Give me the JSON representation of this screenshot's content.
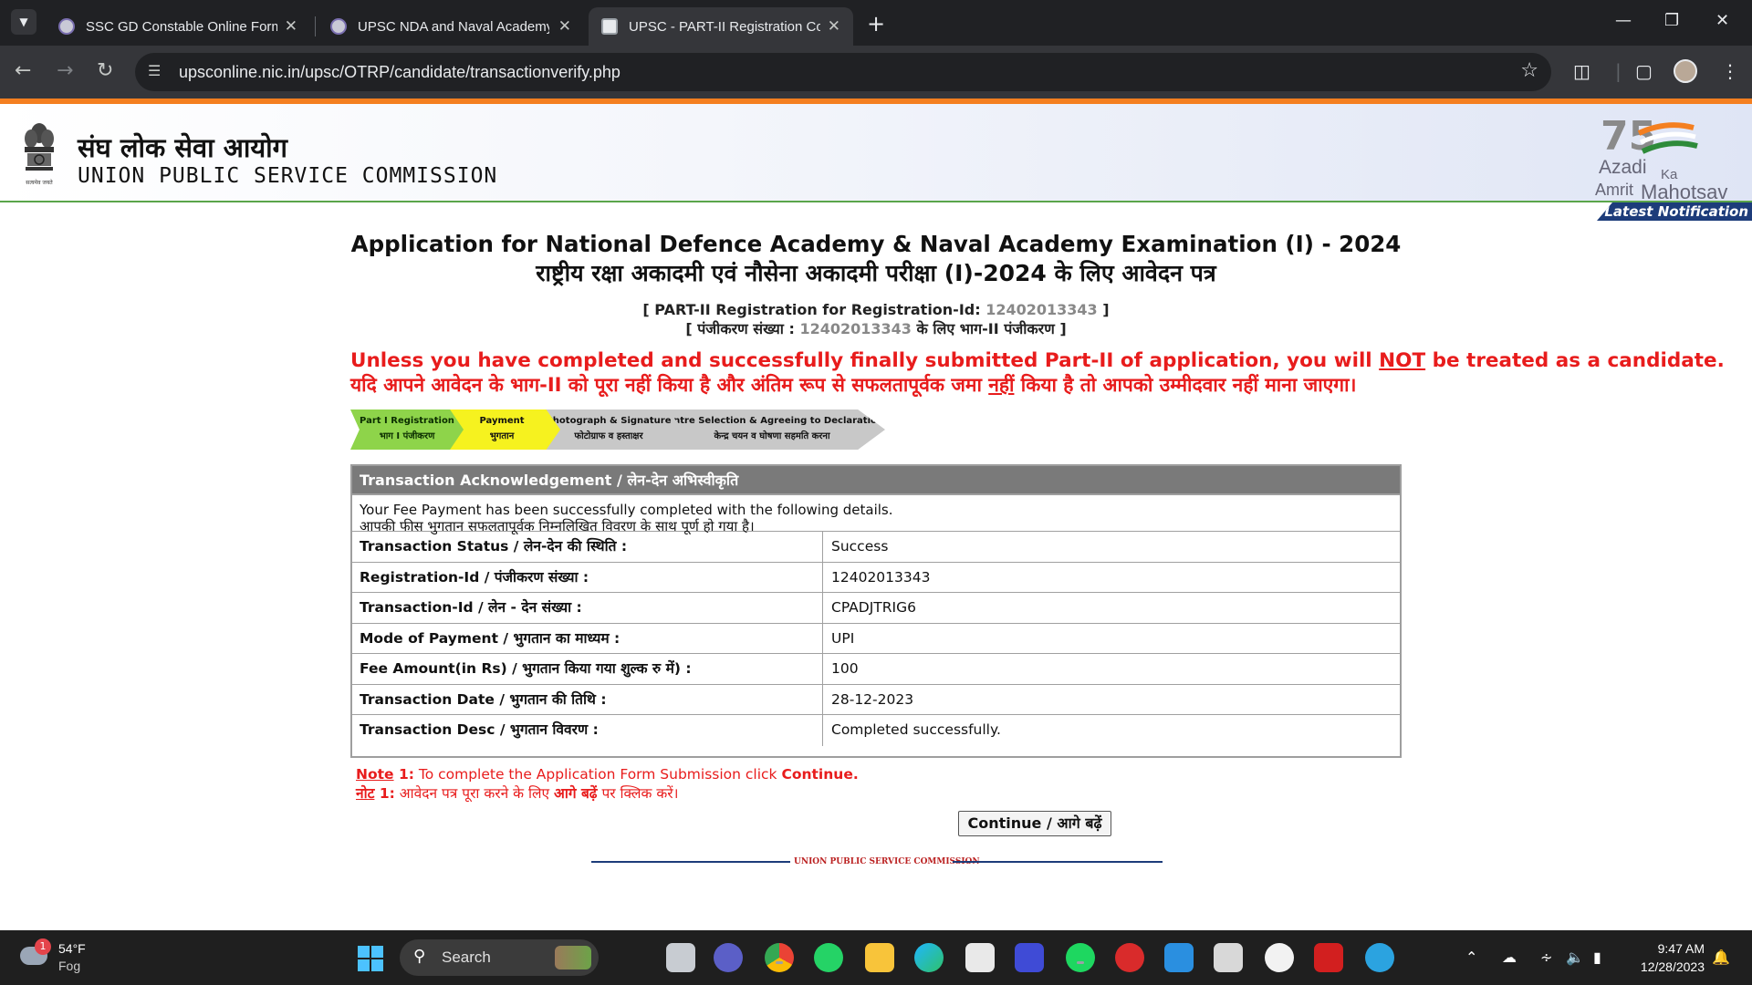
{
  "browser": {
    "tabs": [
      {
        "title": "SSC GD Constable Online Form"
      },
      {
        "title": "UPSC NDA and Naval Academy"
      },
      {
        "title": "UPSC - PART-II Registration Cor"
      }
    ],
    "url": "upsconline.nic.in/upsc/OTRP/candidate/transactionverify.php"
  },
  "header": {
    "hindi_name": "संघ लोक सेवा आयोग",
    "english_name": "UNION PUBLIC SERVICE COMMISSION",
    "emblem_caption": "सत्यमेव जयते",
    "logo": {
      "line1": "Azadi",
      "line2": "Ka",
      "line3": "Amrit",
      "line4": "Mahotsav",
      "number": "75"
    },
    "latest_notification": "Latest Notification"
  },
  "page": {
    "title_en": "Application for National Defence Academy & Naval Academy Examination (I) - 2024",
    "title_hi": "राष्ट्रीय रक्षा अकादमी एवं नौसेना अकादमी परीक्षा (I)-2024 के लिए आवेदन पत्र",
    "reg_line_en_prefix": "[ PART-II Registration for Registration-Id: ",
    "reg_id": "12402013343",
    "reg_line_en_suffix": " ]",
    "reg_line_hi_prefix": "[ पंजीकरण संख्या : ",
    "reg_line_hi_suffix": " के लिए भाग-II पंजीकरण ]",
    "warning_en_1": "Unless you have completed and successfully finally submitted Part-II of application, you will ",
    "warning_en_not": "NOT",
    "warning_en_2": " be treated as a candidate.",
    "warning_hi_1": "यदि आपने आवेदन के भाग-II को पूरा नहीं किया है और अंतिम रूप से सफलतापूर्वक जमा ",
    "warning_hi_not": "नहीं",
    "warning_hi_2": " किया है तो आपको उम्मीदवार नहीं माना जाएगा।"
  },
  "steps": [
    {
      "en": "Part I Registration",
      "hi": "भाग I पंजीकरण"
    },
    {
      "en": "Payment",
      "hi": "भुगतान"
    },
    {
      "en": "Photograph & Signature",
      "hi": "फोटोग्राफ व हस्ताक्षर"
    },
    {
      "en": "Centre Selection & Agreeing to Declaration",
      "hi": "केन्द्र चयन व घोषणा सहमति करना"
    }
  ],
  "ack": {
    "heading": "Transaction Acknowledgement / लेन-देन अभिस्वीकृति",
    "intro_en": "Your Fee Payment has been successfully completed with the following details.",
    "intro_hi": "आपकी फीस भुगतान सफलतापूर्वक निम्नलिखित विवरण के साथ पूर्ण हो गया है।",
    "rows": [
      {
        "label": "Transaction Status / लेन-देन की स्थिति :",
        "value": "Success"
      },
      {
        "label": "Registration-Id / पंजीकरण संख्या :",
        "value": "12402013343"
      },
      {
        "label": "Transaction-Id / लेन - देन संख्या :",
        "value": "CPADJTRIG6"
      },
      {
        "label": "Mode of Payment / भुगतान का माध्यम :",
        "value": "UPI"
      },
      {
        "label": "Fee Amount(in Rs) / भुगतान किया गया शुल्क रु में) :",
        "value": "100"
      },
      {
        "label": "Transaction Date / भुगतान की तिथि :",
        "value": "28-12-2023"
      },
      {
        "label": "Transaction Desc / भुगतान विवरण :",
        "value": "Completed successfully."
      }
    ]
  },
  "notes": {
    "en_label": "Note",
    "en_num": " 1:",
    "en_text": " To complete the Application Form Submission click ",
    "en_bold": "Continue.",
    "hi_label": "नोट",
    "hi_num": " 1:",
    "hi_text": " आवेदन पत्र पूरा करने के लिए ",
    "hi_bold": "आगे बढ़ें",
    "hi_text2": " पर क्लिक करें।"
  },
  "continue_label": "Continue / आगे बढ़ें",
  "footer_text": "UNION PUBLIC SERVICE COMMISSION",
  "taskbar": {
    "weather_temp": "54°F",
    "weather_cond": "Fog",
    "weather_badge": "1",
    "search": "Search",
    "time": "9:47 AM",
    "date": "12/28/2023"
  }
}
